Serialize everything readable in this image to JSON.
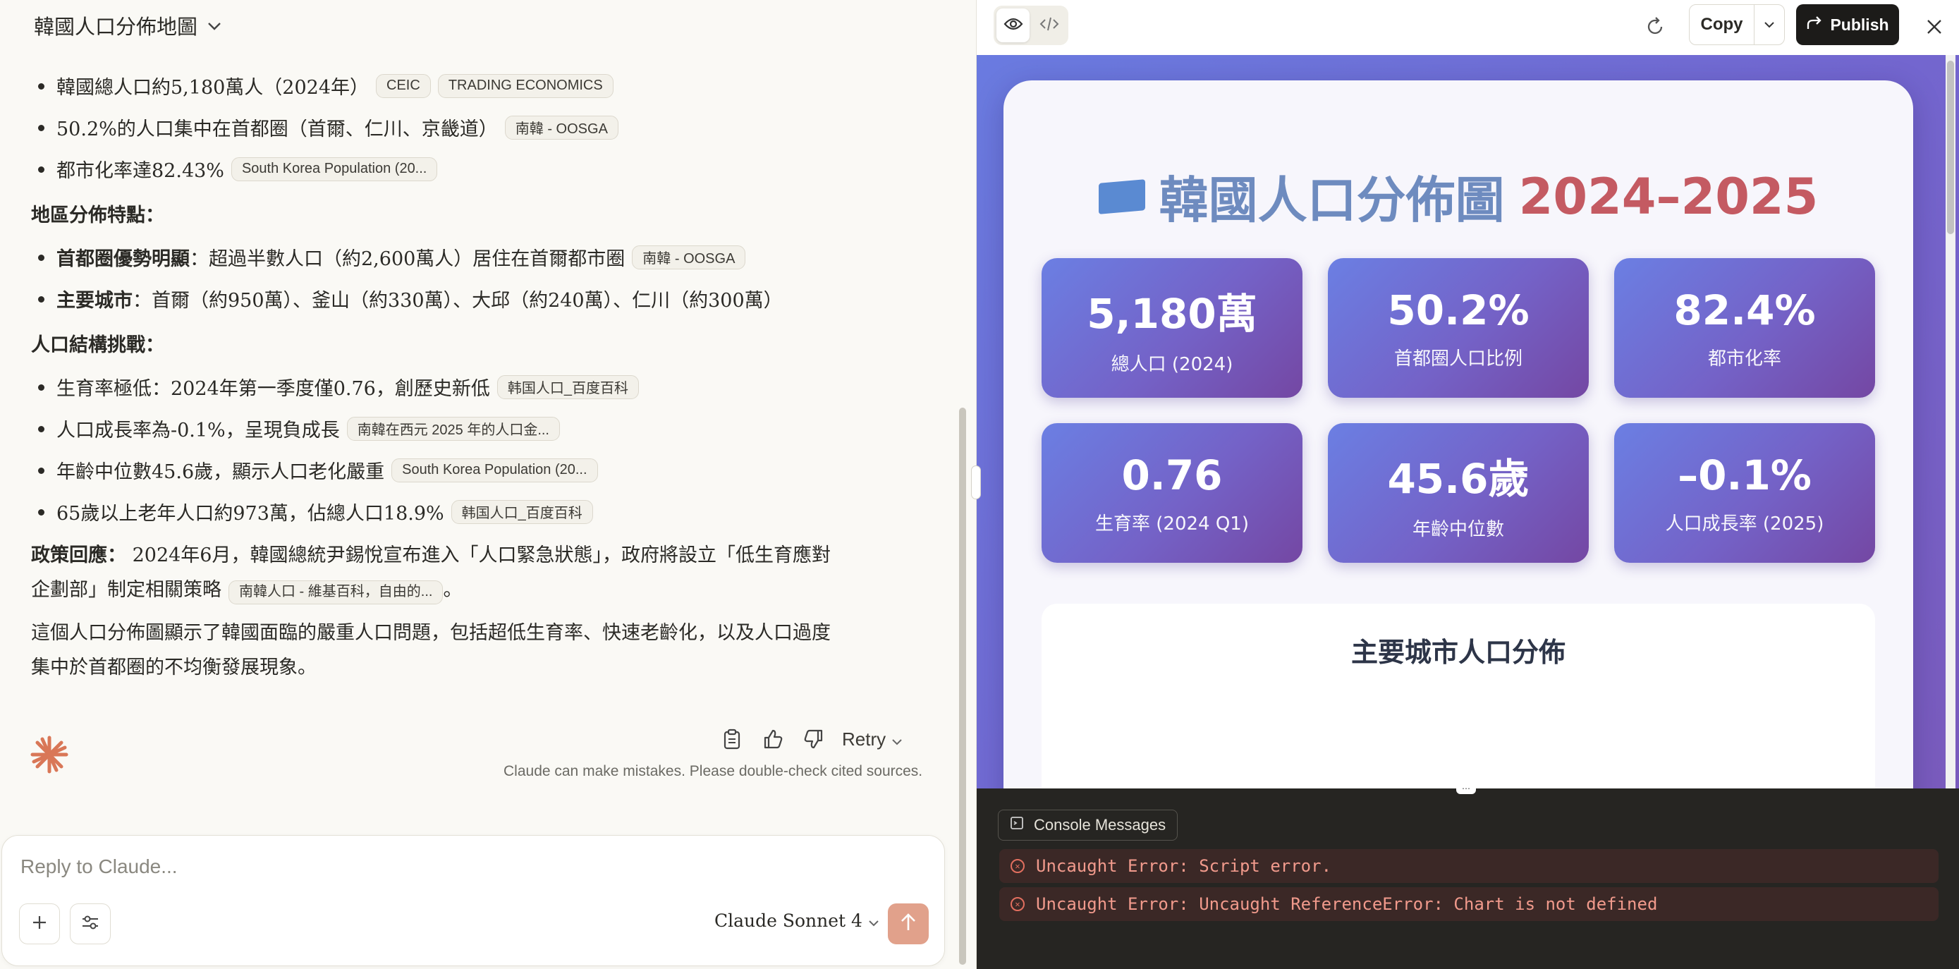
{
  "chat": {
    "title": "韓國人口分佈地圖",
    "overview": [
      {
        "text": "韓國總人口約5,180萬人（2024年）",
        "chips": [
          "CEIC",
          "TRADING ECONOMICS"
        ]
      },
      {
        "text": "50.2%的人口集中在首都圈（首爾、仁川、京畿道）",
        "chips": [
          "南韓 - OOSGA"
        ]
      },
      {
        "text": "都市化率達82.43%",
        "chips": [
          "South Korea Population (20..."
        ]
      }
    ],
    "section_region": "地區分佈特點：",
    "region": [
      {
        "bold": "首都圈優勢明顯",
        "text": "：超過半數人口（約2,600萬人）居住在首爾都市圈",
        "chips": [
          "南韓 - OOSGA"
        ]
      },
      {
        "bold": "主要城市",
        "text": "：首爾（約950萬）、釜山（約330萬）、大邱（約240萬）、仁川（約300萬）",
        "chips": []
      }
    ],
    "section_challenges": "人口結構挑戰：",
    "challenges": [
      {
        "text": "生育率極低：2024年第一季度僅0.76，創歷史新低",
        "chips": [
          "韩国人口_百度百科"
        ]
      },
      {
        "text": "人口成長率為-0.1%，呈現負成長",
        "chips": [
          "南韓在西元 2025 年的人口金..."
        ]
      },
      {
        "text": "年齡中位數45.6歲，顯示人口老化嚴重",
        "chips": [
          "South Korea Population (20..."
        ]
      },
      {
        "text": "65歲以上老年人口約973萬，佔總人口18.9%",
        "chips": [
          "韩国人口_百度百科"
        ]
      }
    ],
    "policy_label": "政策回應：",
    "policy_text_1": "2024年6月，韓國總統尹錫悅宣布進入「人口緊急狀態」，政府將設立「低生育應對",
    "policy_text_2": "企劃部」制定相關策略",
    "policy_chip": "南韓人口 - 維基百科，自由的...",
    "policy_end": "。",
    "summary_1": "這個人口分佈圖顯示了韓國面臨的嚴重人口問題，包括超低生育率、快速老齡化，以及人口過度",
    "summary_2": "集中於首都圈的不均衡發展現象。",
    "retry_label": "Retry",
    "disclaimer": "Claude can make mistakes. Please double-check cited sources.",
    "reply_placeholder": "Reply to Claude...",
    "model_name": "Claude Sonnet 4"
  },
  "artifact": {
    "copy_label": "Copy",
    "publish_label": "Publish",
    "hero_title": "韓國人口分佈圖",
    "hero_years": "2024–2025",
    "stats": [
      {
        "value": "5,180萬",
        "label": "總人口 (2024)"
      },
      {
        "value": "50.2%",
        "label": "首都圈人口比例"
      },
      {
        "value": "82.4%",
        "label": "都市化率"
      },
      {
        "value": "0.76",
        "label": "生育率 (2024 Q1)"
      },
      {
        "value": "45.6歲",
        "label": "年齡中位數"
      },
      {
        "value": "–0.1%",
        "label": "人口成長率 (2025)"
      }
    ],
    "cities_title": "主要城市人口分佈",
    "console_tab": "Console Messages",
    "errors": [
      "Uncaught Error: Script error.",
      "Uncaught Error: Uncaught ReferenceError: Chart is not defined"
    ]
  },
  "colors": {
    "accent": "#e1a18b",
    "gradient_start": "#6b7fe3",
    "gradient_end": "#7447a3",
    "error_text": "#f19a8c"
  },
  "icons": [
    "chevron-down-icon",
    "claude-spark-icon",
    "clipboard-icon",
    "thumbs-up-icon",
    "thumbs-down-icon",
    "plus-icon",
    "sliders-icon",
    "arrow-up-icon",
    "eye-icon",
    "code-icon",
    "refresh-icon",
    "share-arrow-icon",
    "close-icon",
    "console-icon",
    "error-icon",
    "flag-icon"
  ]
}
